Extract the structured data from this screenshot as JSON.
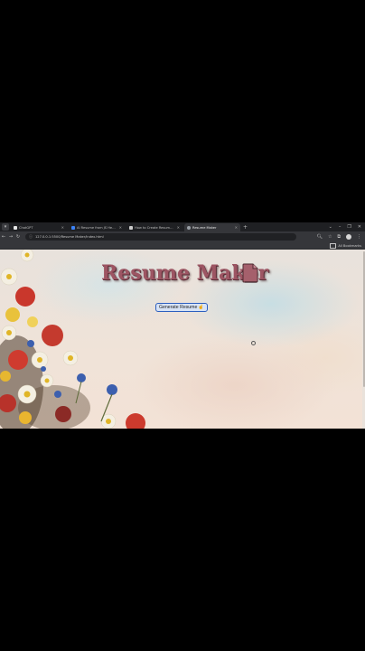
{
  "browser": {
    "tabs": [
      {
        "label": "ChatGPT",
        "active": false,
        "favicon_color": "#e6e6e6"
      },
      {
        "label": "AI Resume from JS Header",
        "active": false,
        "favicon_color": "#3b82f6"
      },
      {
        "label": "How to Create Resume Maker App",
        "active": false,
        "favicon_color": "#cccccc"
      },
      {
        "label": "Resume Maker",
        "active": true,
        "favicon_color": "#9aa0a6"
      }
    ],
    "new_tab_symbol": "+",
    "window_controls": [
      "⌄",
      "–",
      "❐",
      "✕"
    ],
    "url": "127.0.0.1:5500/Resume Maker/index.html",
    "bookmarks_label": "All Bookmarks"
  },
  "page": {
    "title": "Resume Maker",
    "title_icon": "document-icon",
    "generate_button_label": "Generate Resume",
    "generate_button_icon": "hand-pointer-icon"
  }
}
